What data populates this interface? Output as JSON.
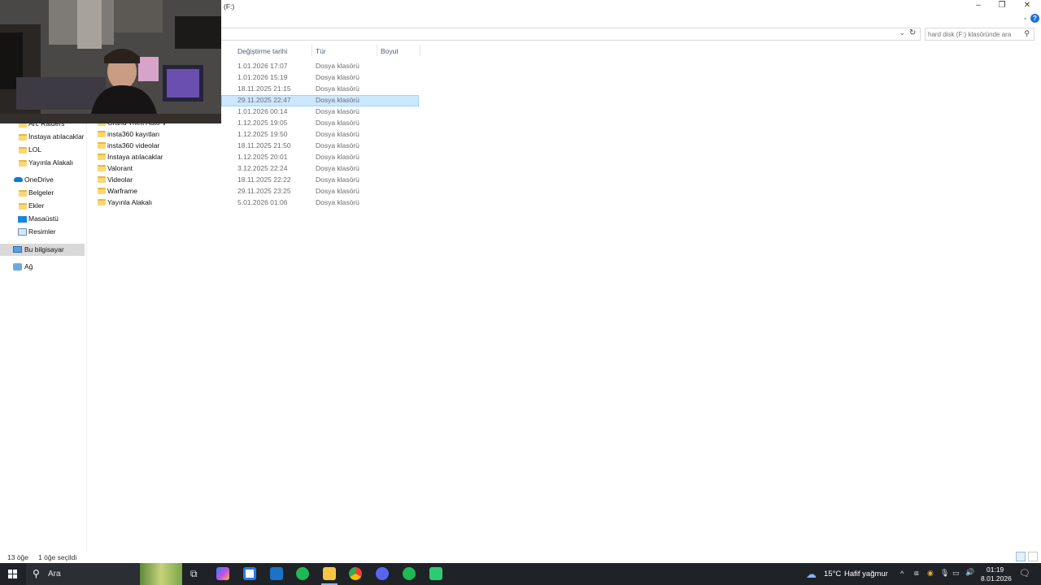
{
  "window": {
    "title": "(F:)",
    "minimize": "–",
    "restore": "❐",
    "close": "✕",
    "ribbon_toggle": "⌄",
    "help": "?"
  },
  "toolbar": {
    "refresh_glyph": "↻",
    "dropdown_glyph": "⌄"
  },
  "search": {
    "placeholder": "hard disk (F:) klasöründe ara"
  },
  "columns": {
    "modified": "Değiştirme tarihi",
    "type": "Tür",
    "size": "Boyut"
  },
  "files": {
    "rows": [
      {
        "modified": "1.01.2026 17:07",
        "type": "Dosya klasörü"
      },
      {
        "modified": "1.01.2026 15:19",
        "type": "Dosya klasörü"
      },
      {
        "modified": "18.11.2025 21:15",
        "type": "Dosya klasörü"
      },
      {
        "modified": "29.11.2025 22:47",
        "type": "Dosya klasörü"
      },
      {
        "modified": "1.01.2026 00:14",
        "type": "Dosya klasörü"
      },
      {
        "name": "Grand Theft Auto V",
        "modified": "1.12.2025 19:05",
        "type": "Dosya klasörü"
      },
      {
        "name": "insta360 kayıtları",
        "modified": "1.12.2025 19:50",
        "type": "Dosya klasörü"
      },
      {
        "name": "insta360 videolar",
        "modified": "18.11.2025 21:50",
        "type": "Dosya klasörü"
      },
      {
        "name": "İnstaya atılacaklar",
        "modified": "1.12.2025 20:01",
        "type": "Dosya klasörü"
      },
      {
        "name": "Valorant",
        "modified": "3.12.2025 22:24",
        "type": "Dosya klasörü"
      },
      {
        "name": "Videolar",
        "modified": "18.11.2025 22:22",
        "type": "Dosya klasörü"
      },
      {
        "name": "Warframe",
        "modified": "29.11.2025 23:25",
        "type": "Dosya klasörü"
      },
      {
        "name": "Yayınla Alakalı",
        "modified": "5.01.2026 01:06",
        "type": "Dosya klasörü"
      }
    ]
  },
  "nav": {
    "quick": [
      "Arc Raiders",
      "İnstaya atılacaklar",
      "LOL",
      "Yayınla Alakalı"
    ],
    "onedrive": "OneDrive",
    "onedrive_items": [
      "Belgeler",
      "Ekler",
      "Masaüstü",
      "Resimler"
    ],
    "this_pc": "Bu bilgisayar",
    "network": "Ağ"
  },
  "status": {
    "count": "13 öğe",
    "selected": "1 öğe seçildi"
  },
  "taskbar": {
    "search_text": "Ara",
    "weather": "15°C",
    "weather_desc": "Hafif yağmur",
    "time": "01:19",
    "date": "8.01.2026",
    "tray_chevron": "^"
  }
}
